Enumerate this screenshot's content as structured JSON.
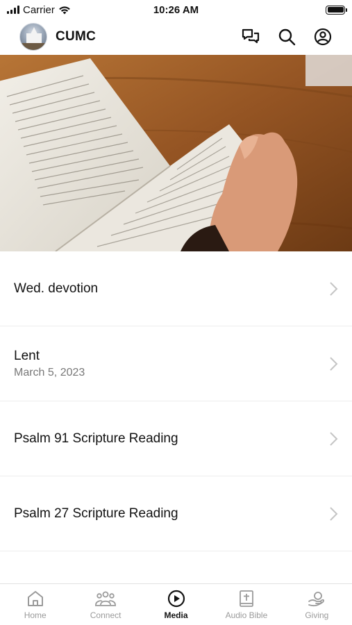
{
  "status_bar": {
    "carrier": "Carrier",
    "time": "10:26 AM"
  },
  "header": {
    "title": "CUMC",
    "icons": [
      "chat-icon",
      "search-icon",
      "profile-icon"
    ]
  },
  "hero": {
    "description_icon": "open-bible-photo"
  },
  "list": {
    "items": [
      {
        "title": "Wed. devotion",
        "subtitle": ""
      },
      {
        "title": "Lent",
        "subtitle": "March 5, 2023"
      },
      {
        "title": "Psalm 91 Scripture Reading",
        "subtitle": ""
      },
      {
        "title": "Psalm 27 Scripture Reading",
        "subtitle": ""
      }
    ]
  },
  "tabs": [
    {
      "label": "Home",
      "icon": "home-icon",
      "active": false
    },
    {
      "label": "Connect",
      "icon": "people-icon",
      "active": false
    },
    {
      "label": "Media",
      "icon": "play-icon",
      "active": true
    },
    {
      "label": "Audio Bible",
      "icon": "bible-icon",
      "active": false
    },
    {
      "label": "Giving",
      "icon": "giving-icon",
      "active": false
    }
  ],
  "colors": {
    "active_tab": "#111111",
    "inactive_tab": "#9a9a9a",
    "subtitle": "#777777"
  }
}
